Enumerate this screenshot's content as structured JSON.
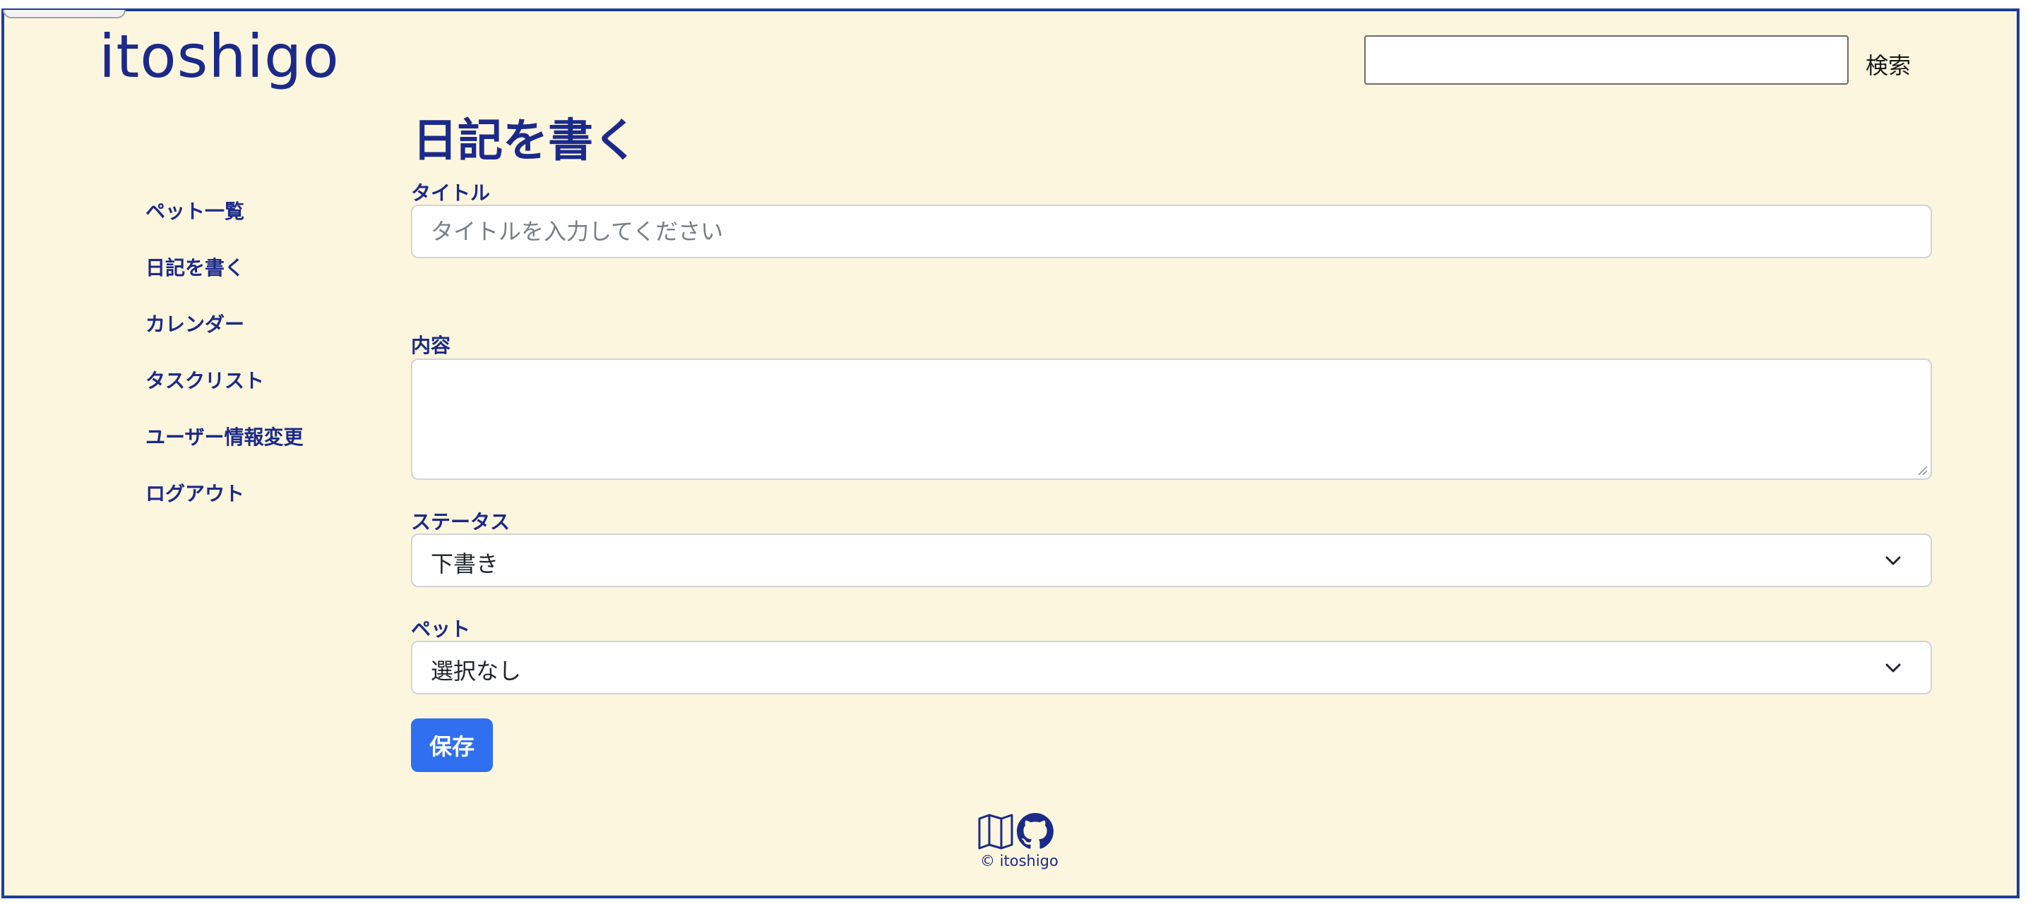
{
  "header": {
    "brand": "itoshigo",
    "search_placeholder": "",
    "search_button": "検索"
  },
  "sidebar": {
    "items": [
      {
        "label": "ペット一覧"
      },
      {
        "label": "日記を書く"
      },
      {
        "label": "カレンダー"
      },
      {
        "label": "タスクリスト"
      },
      {
        "label": "ユーザー情報変更"
      },
      {
        "label": "ログアウト"
      }
    ]
  },
  "main": {
    "title": "日記を書く",
    "title_field": {
      "label": "タイトル",
      "placeholder": "タイトルを入力してください",
      "value": ""
    },
    "content_field": {
      "label": "内容",
      "value": ""
    },
    "status_field": {
      "label": "ステータス",
      "selected": "下書き"
    },
    "pet_field": {
      "label": "ペット",
      "selected": "選択なし"
    },
    "save_button": "保存"
  },
  "footer": {
    "icons": [
      "map-icon",
      "github-icon"
    ],
    "copyright": "© itoshigo"
  },
  "colors": {
    "background": "#fdf6de",
    "frame_border": "#1f3d99",
    "text_primary": "#1b2a8a",
    "primary_button": "#2f6ff0"
  }
}
